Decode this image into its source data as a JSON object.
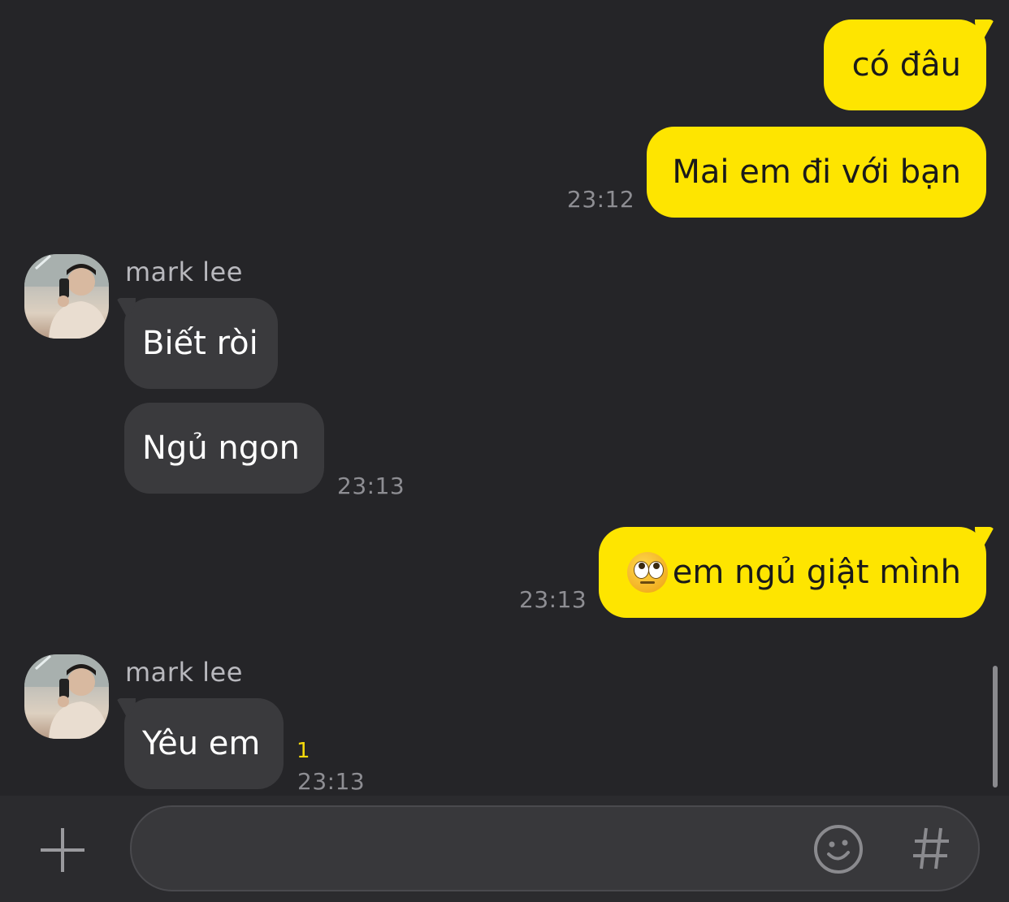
{
  "messages": [
    {
      "text": "có đâu"
    },
    {
      "text": "Mai em đi với bạn",
      "time": "23:12"
    },
    {
      "sender": "mark lee",
      "text": "Biết ròi"
    },
    {
      "text": "Ngủ ngon",
      "time": "23:13"
    },
    {
      "text": "em ngủ giật mình",
      "time": "23:13",
      "emoji": "face-with-rolling-eyes"
    },
    {
      "sender": "mark lee",
      "text": "Yêu em",
      "unread": "1",
      "time": "23:13"
    }
  ],
  "input": {
    "value": "",
    "placeholder": ""
  },
  "icons": {
    "add": "plus-icon",
    "emoticon": "smiley-icon",
    "hashtag": "hash-icon"
  },
  "colors": {
    "background": "#252528",
    "my_bubble": "#fee500",
    "their_bubble": "#3a3a3d",
    "unread": "#f5d90b"
  }
}
